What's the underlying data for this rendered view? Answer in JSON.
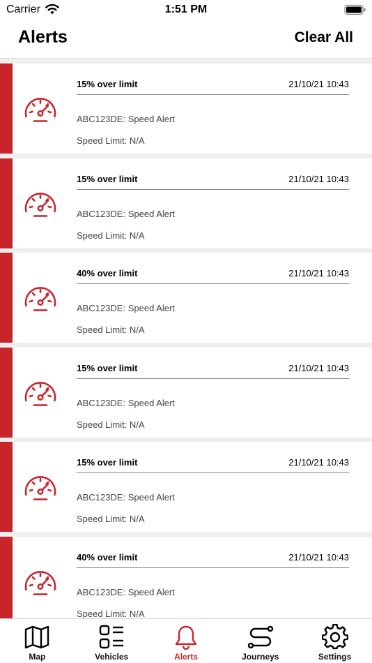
{
  "status_bar": {
    "carrier": "Carrier",
    "time": "1:51 PM"
  },
  "header": {
    "title": "Alerts",
    "clear_all_label": "Clear All"
  },
  "colors": {
    "accent": "#c8242c",
    "list_background": "#eeeeee"
  },
  "alerts": [
    {
      "title": "15% over limit",
      "time": "21/10/21 10:43",
      "description": "ABC123DE: Speed Alert",
      "speed_limit": "Speed Limit: N/A",
      "icon": "speedometer-icon"
    },
    {
      "title": "15% over limit",
      "time": "21/10/21 10:43",
      "description": "ABC123DE: Speed Alert",
      "speed_limit": "Speed Limit: N/A",
      "icon": "speedometer-icon"
    },
    {
      "title": "40% over limit",
      "time": "21/10/21 10:43",
      "description": "ABC123DE: Speed Alert",
      "speed_limit": "Speed Limit: N/A",
      "icon": "speedometer-icon"
    },
    {
      "title": "15% over limit",
      "time": "21/10/21 10:43",
      "description": "ABC123DE: Speed Alert",
      "speed_limit": "Speed Limit: N/A",
      "icon": "speedometer-icon"
    },
    {
      "title": "15% over limit",
      "time": "21/10/21 10:43",
      "description": "ABC123DE: Speed Alert",
      "speed_limit": "Speed Limit: N/A",
      "icon": "speedometer-icon"
    },
    {
      "title": "40% over limit",
      "time": "21/10/21 10:43",
      "description": "ABC123DE: Speed Alert",
      "speed_limit": "Speed Limit: N/A",
      "icon": "speedometer-icon"
    }
  ],
  "tab_bar": {
    "active": "Alerts",
    "tabs": [
      {
        "label": "Map",
        "icon": "map-icon"
      },
      {
        "label": "Vehicles",
        "icon": "vehicles-list-icon"
      },
      {
        "label": "Alerts",
        "icon": "bell-icon"
      },
      {
        "label": "Journeys",
        "icon": "route-icon"
      },
      {
        "label": "Settings",
        "icon": "gear-icon"
      }
    ]
  }
}
